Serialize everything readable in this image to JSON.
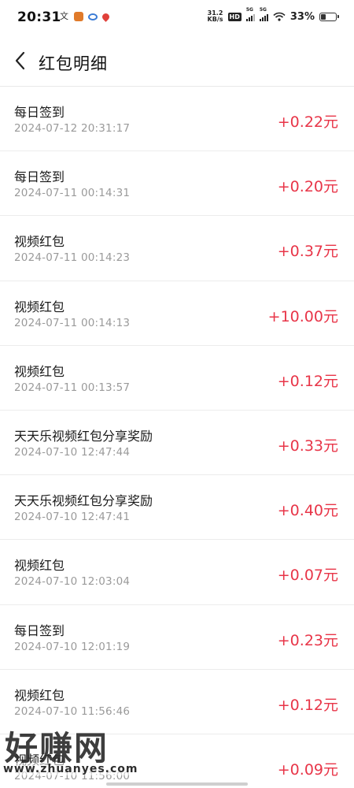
{
  "status_bar": {
    "time": "20:31",
    "net_speed_value": "31.2",
    "net_speed_unit": "KB/s",
    "hd_label": "HD",
    "sim1_label": "5G",
    "sim2_label": "5G",
    "battery_text": "33%",
    "battery_level": 0.33
  },
  "header": {
    "title": "红包明细",
    "back_icon": "chevron-left-icon"
  },
  "records": [
    {
      "title": "每日签到",
      "time": "2024-07-12 20:31:17",
      "amount": "+0.22元"
    },
    {
      "title": "每日签到",
      "time": "2024-07-11 00:14:31",
      "amount": "+0.20元"
    },
    {
      "title": "视频红包",
      "time": "2024-07-11 00:14:23",
      "amount": "+0.37元"
    },
    {
      "title": "视频红包",
      "time": "2024-07-11 00:14:13",
      "amount": "+10.00元"
    },
    {
      "title": "视频红包",
      "time": "2024-07-11 00:13:57",
      "amount": "+0.12元"
    },
    {
      "title": "天天乐视频红包分享奖励",
      "time": "2024-07-10 12:47:44",
      "amount": "+0.33元"
    },
    {
      "title": "天天乐视频红包分享奖励",
      "time": "2024-07-10 12:47:41",
      "amount": "+0.40元"
    },
    {
      "title": "视频红包",
      "time": "2024-07-10 12:03:04",
      "amount": "+0.07元"
    },
    {
      "title": "每日签到",
      "time": "2024-07-10 12:01:19",
      "amount": "+0.23元"
    },
    {
      "title": "视频红包",
      "time": "2024-07-10 11:56:46",
      "amount": "+0.12元"
    },
    {
      "title": "视频红包",
      "time": "2024-07-10 11:56:00",
      "amount": "+0.09元"
    }
  ],
  "watermark": {
    "main": "好赚网",
    "url": "www.zhuanyes.com"
  },
  "colors": {
    "amount": "#e83548",
    "time": "#9a9a9a"
  }
}
